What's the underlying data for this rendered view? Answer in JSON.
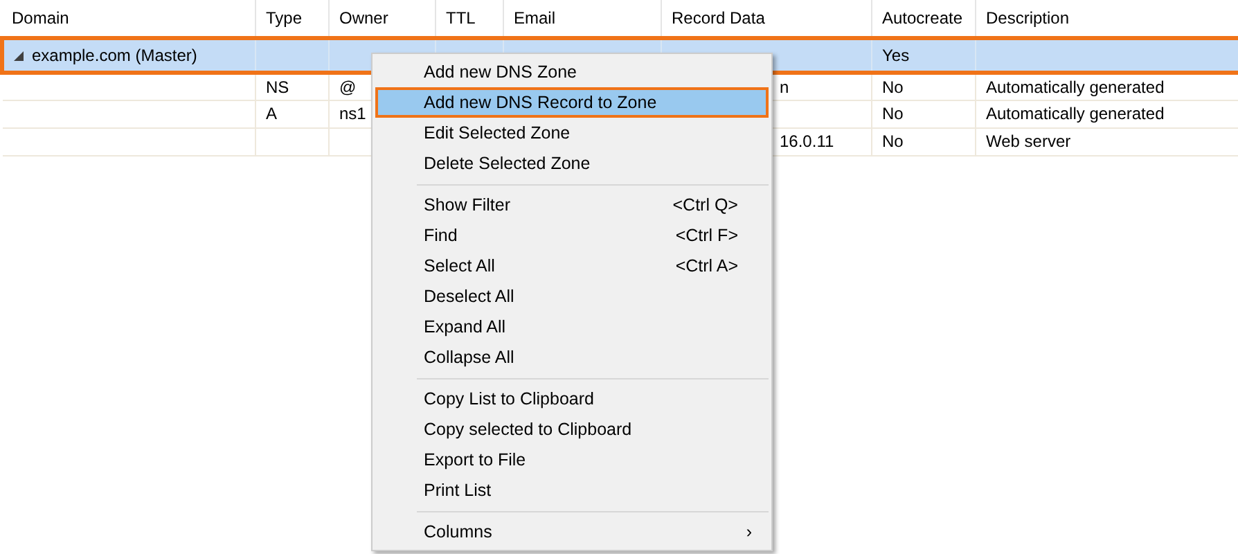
{
  "table": {
    "columns": [
      "Domain",
      "Type",
      "Owner",
      "TTL",
      "Email",
      "Record Data",
      "Autocreate",
      "Description"
    ],
    "rows": [
      {
        "expanded": true,
        "selected": true,
        "cells": [
          "example.com (Master)",
          "",
          "",
          "",
          "",
          "",
          "Yes",
          ""
        ]
      },
      {
        "selected": false,
        "cells": [
          "",
          "NS",
          "@",
          "",
          "",
          "n",
          "No",
          "Automatically generated"
        ]
      },
      {
        "selected": false,
        "cells": [
          "",
          "A",
          "ns1",
          "",
          "",
          "",
          "No",
          "Automatically generated"
        ]
      },
      {
        "selected": false,
        "cells": [
          "",
          "",
          "",
          "",
          "",
          "16.0.11",
          "No",
          "Web server"
        ]
      }
    ]
  },
  "context_menu": {
    "items": [
      {
        "kind": "item",
        "label": "Add new DNS Zone",
        "selected": false
      },
      {
        "kind": "item",
        "label": "Add new DNS Record to Zone",
        "selected": true
      },
      {
        "kind": "item",
        "label": "Edit Selected Zone",
        "selected": false
      },
      {
        "kind": "item",
        "label": "Delete Selected Zone",
        "selected": false
      },
      {
        "kind": "separator"
      },
      {
        "kind": "item",
        "label": "Show Filter",
        "shortcut": "<Ctrl Q>",
        "selected": false
      },
      {
        "kind": "item",
        "label": "Find",
        "shortcut": "<Ctrl F>",
        "selected": false
      },
      {
        "kind": "item",
        "label": "Select All",
        "shortcut": "<Ctrl A>",
        "selected": false
      },
      {
        "kind": "item",
        "label": "Deselect All",
        "selected": false
      },
      {
        "kind": "item",
        "label": "Expand All",
        "selected": false
      },
      {
        "kind": "item",
        "label": "Collapse All",
        "selected": false
      },
      {
        "kind": "separator"
      },
      {
        "kind": "item",
        "label": "Copy List to Clipboard",
        "selected": false
      },
      {
        "kind": "item",
        "label": "Copy selected to Clipboard",
        "selected": false
      },
      {
        "kind": "item",
        "label": "Export to File",
        "selected": false
      },
      {
        "kind": "item",
        "label": "Print List",
        "selected": false
      },
      {
        "kind": "separator"
      },
      {
        "kind": "submenu",
        "label": "Columns",
        "arrow": "›",
        "selected": false
      }
    ]
  }
}
